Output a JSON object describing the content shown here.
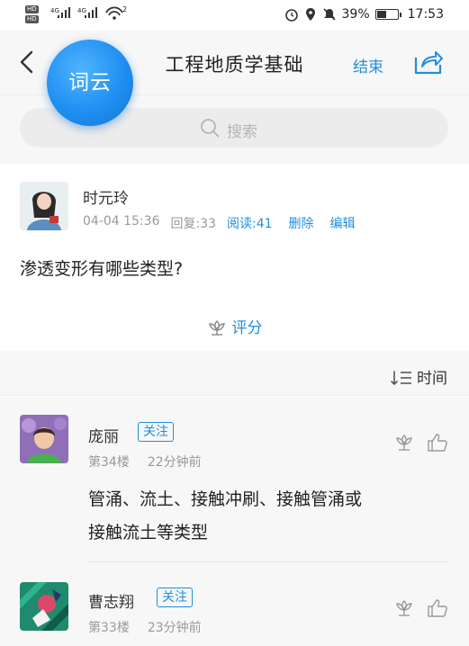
{
  "status_bar": {
    "sim1": "HD",
    "sim2": "HD",
    "net1": "4G",
    "net2": "4G",
    "wifi_badge": "2",
    "battery": "39%",
    "time": "17:53"
  },
  "nav": {
    "title": "工程地质学基础",
    "end_label": "结束",
    "badge": "词云"
  },
  "search": {
    "placeholder": "搜索"
  },
  "post": {
    "author": "时元玲",
    "datetime": "04-04 15:36",
    "replies": "回复:33",
    "reads": "阅读:41",
    "delete_label": "删除",
    "edit_label": "编辑",
    "question": "渗透变形有哪些类型?",
    "rate_label": "评分"
  },
  "sort": {
    "label": "时间"
  },
  "replies": [
    {
      "name": "庞丽",
      "follow_label": "关注",
      "floor": "第34楼",
      "time_ago": "22分钟前",
      "text_line1": "管涌、流土、接触冲刷、接触管涌或",
      "text_line2": "接触流土等类型"
    },
    {
      "name": "曹志翔",
      "follow_label": "关注",
      "floor": "第33楼",
      "time_ago": "23分钟前"
    }
  ],
  "colors": {
    "accent": "#1e8fe1",
    "badge": "#1f8ff2",
    "background": "#f7f7f7"
  }
}
